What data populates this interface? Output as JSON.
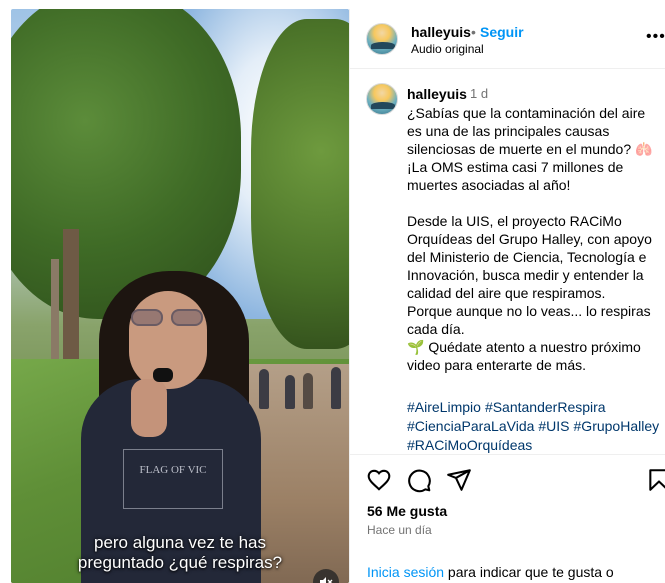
{
  "video": {
    "caption_line_1": "pero alguna vez te has",
    "caption_line_2": "preguntado ¿qué respiras?",
    "shirt_print": "FLAG OF VIC",
    "mute_icon": "speaker-muted-icon"
  },
  "header": {
    "username": "halleyuis",
    "separator": "•",
    "follow_label": "Seguir",
    "audio_label": "Audio original",
    "more_icon": "more-options-icon"
  },
  "post": {
    "username": "halleyuis",
    "time_ago": "1 d",
    "caption": "¿Sabías que la contaminación del aire es una de las principales causas silenciosas de muerte en el mundo? 🫁\n¡La OMS estima casi 7 millones de muertes asociadas al año!\n\nDesde la UIS, el proyecto RACiMo Orquídeas del Grupo Halley, con apoyo del Ministerio de Ciencia, Tecnología e Innovación, busca medir y entender la calidad del aire que respiramos.\nPorque aunque no lo veas... lo respiras cada día.\n🌱 Quédate atento a nuestro próximo video para enterarte de más.",
    "hashtags": [
      "#AireLimpio",
      "#SantanderRespira",
      "#CienciaParaLaVida",
      "#UIS",
      "#GrupoHalley",
      "#RACiMoOrquídeas"
    ]
  },
  "actions": {
    "likes": "56 Me gusta",
    "posted": "Hace un día",
    "login_link": "Inicia sesión",
    "login_rest": " para indicar que te gusta o"
  },
  "colors": {
    "link_blue": "#0095f6",
    "hashtag_blue": "#00376b",
    "muted_text": "#737373"
  }
}
